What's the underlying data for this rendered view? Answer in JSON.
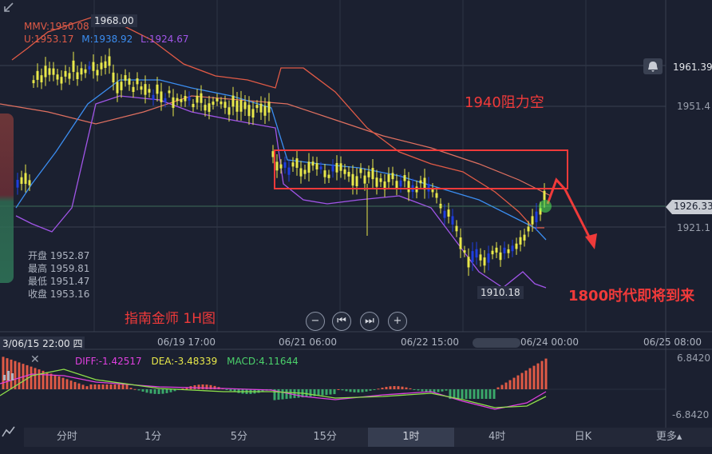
{
  "main_legend": {
    "mmv": "MMV:1950.08",
    "upper": "U:1953.17",
    "mid": "M:1938.92",
    "lower": "L:1924.67"
  },
  "colors": {
    "upper": "#e05a46",
    "mid": "#3b8df0",
    "lower": "#a155e8",
    "ma": "#e07060",
    "candle": "#e8e84a",
    "candle_blue": "#1f3ee0",
    "annot_red": "#f03a3a"
  },
  "price_axis": {
    "p1961": "1961.39",
    "p1951": "1951.4",
    "p1926": "1926.33",
    "p1921": "1921.1"
  },
  "high_marker": "1968.00",
  "low_marker": "1910.18",
  "annotations": {
    "resistance": "1940阻力空",
    "target": "1800时代即将到来",
    "watermark": "指南金师 1H图"
  },
  "ohlc": {
    "open": "开盘 1952.87",
    "high": "最高 1959.81",
    "low": "最低 1951.47",
    "close": "收盘 1953.16"
  },
  "x_axis": {
    "start": "3/06/15 22:00 四",
    "t1": "06/19 17:00",
    "t2": "06/21 06:00",
    "t3": "06/22 15:00",
    "t4": "06/24 00:00",
    "t5": "06/25 08:00"
  },
  "macd": {
    "diff": "DIFF:-1.42517",
    "dea": "DEA:-3.48339",
    "macd": "MACD:4.11644",
    "max": "6.8420",
    "min": "-6.8420"
  },
  "tabs": [
    "分时",
    "1分",
    "5分",
    "15分",
    "1时",
    "4时",
    "日K",
    "更多▴"
  ],
  "active_tab": "1时"
}
